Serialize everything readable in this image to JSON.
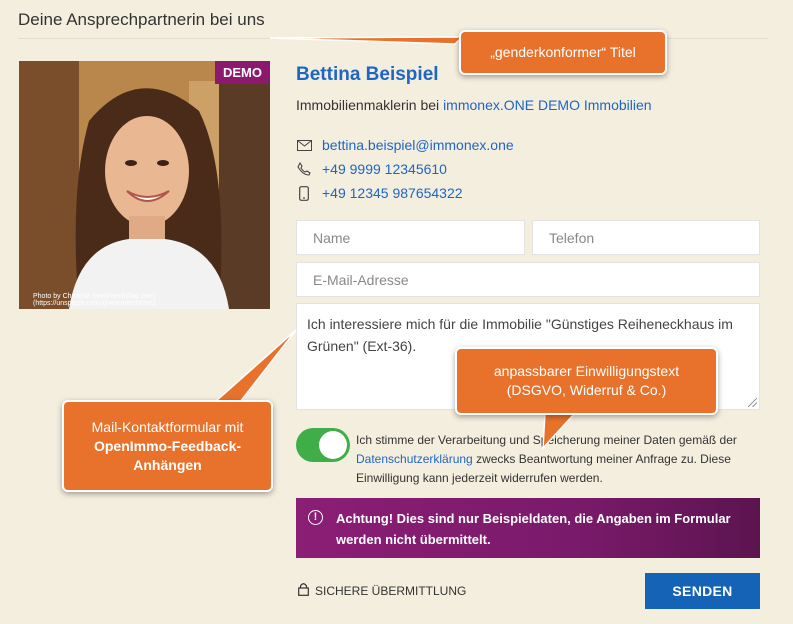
{
  "section_title": "Deine Ansprechpartnerin bei uns",
  "badge": "DEMO",
  "photo_credit": "Photo by Christina (wocintechchat.com) (https://unsplash.com/@wocintechchat)",
  "agent": {
    "name": "Bettina Beispiel",
    "role_prefix": "Immobilienmaklerin bei ",
    "company": "immonex.ONE DEMO Immobilien",
    "email": "bettina.beispiel@immonex.one",
    "phone": "+49 9999 12345610",
    "mobile": "+49 12345 987654322"
  },
  "form": {
    "name_placeholder": "Name",
    "phone_placeholder": "Telefon",
    "email_placeholder": "E-Mail-Adresse",
    "message": "Ich interessiere mich für die Immobilie \"Günstiges Reiheneckhaus im Grünen\" (Ext-36).",
    "consent_before": "Ich stimme der Verarbeitung und Speicherung meiner Daten gemäß der ",
    "consent_link": "Datenschutzerklärung",
    "consent_after": " zwecks Beantwortung meiner Anfrage zu. Diese Einwilligung kann jederzeit widerrufen werden.",
    "consent_checked": true,
    "warning_before": "Achtung! Dies sind nur Beispieldaten, die Angaben im Formular werden ",
    "warning_bold": "nicht",
    "warning_after": " übermittelt.",
    "secure_label": "SICHERE ÜBERMITTLUNG",
    "send_label": "SENDEN"
  },
  "callouts": {
    "title": "„genderkonformer“ Titel",
    "consent_line1": "anpassbarer Einwilligungstext",
    "consent_line2": "(DSGVO, Widerruf & Co.)",
    "mail_line1": "Mail-Kontaktformular mit",
    "mail_line2": "OpenImmo-Feedback-",
    "mail_line3": "Anhängen"
  },
  "colors": {
    "accent": "#1e66c4",
    "badge": "#8b1a6f",
    "callout": "#e8722b",
    "toggle_on": "#3fae49",
    "send": "#1463b7"
  }
}
